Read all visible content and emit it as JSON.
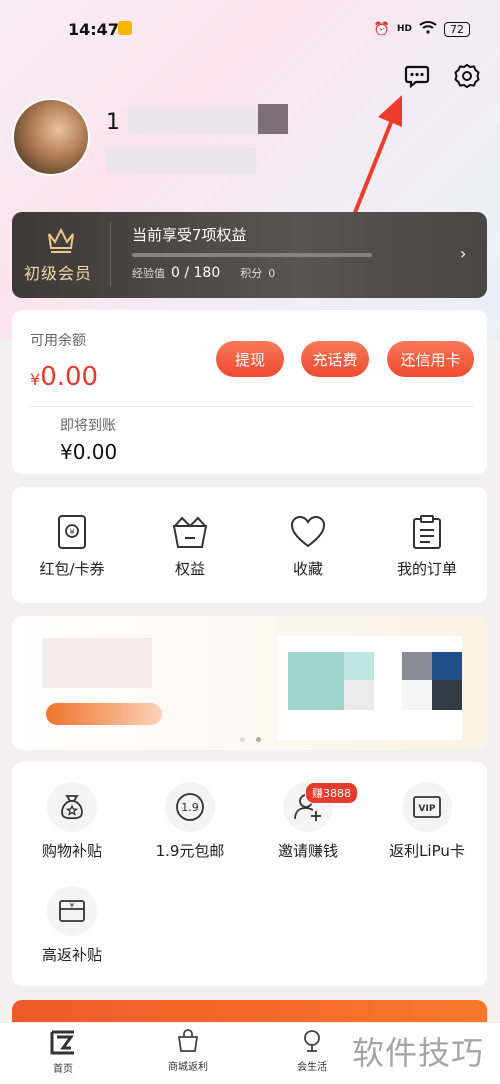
{
  "status_bar": {
    "time": "14:47",
    "battery": "72",
    "network": "HD"
  },
  "user": {
    "name_partial": "1"
  },
  "vip": {
    "level": "初级会员",
    "title": "当前享受7项权益",
    "exp_label": "经验值",
    "exp_value": "0 / 180",
    "points_label": "积分",
    "points_value": "0",
    "progress": 0
  },
  "balance": {
    "label": "可用余额",
    "currency": "¥",
    "value": "0.00",
    "pending_label": "即将到账",
    "pending_value": "¥0.00",
    "buttons": [
      "提现",
      "充话费",
      "还信用卡"
    ]
  },
  "quick_menu": [
    {
      "label": "红包/卡券",
      "icon": "red-packet-icon"
    },
    {
      "label": "权益",
      "icon": "basket-icon"
    },
    {
      "label": "收藏",
      "icon": "heart-icon"
    },
    {
      "label": "我的订单",
      "icon": "clipboard-icon"
    }
  ],
  "services": [
    {
      "label": "购物补贴",
      "icon": "money-bag-icon"
    },
    {
      "label": "1.9元包邮",
      "icon": "coin-icon",
      "icon_text": "1.9"
    },
    {
      "label": "邀请赚钱",
      "icon": "add-user-icon",
      "badge": "赚3888"
    },
    {
      "label": "返利LiPu卡",
      "icon": "vip-card-icon",
      "icon_text": "VIP"
    },
    {
      "label": "高返补贴",
      "icon": "wallet-icon"
    }
  ],
  "tabs": [
    {
      "label": "首页",
      "icon": "home-logo-icon"
    },
    {
      "label": "商城返利",
      "icon": "shop-icon"
    },
    {
      "label": "会生活",
      "icon": "life-icon"
    }
  ],
  "watermark": "软件技巧",
  "colors": {
    "accent": "#e83b2e",
    "button": "#f25a3a",
    "vip_bg": "#4a4543",
    "vip_gold": "#f0d9a8"
  }
}
